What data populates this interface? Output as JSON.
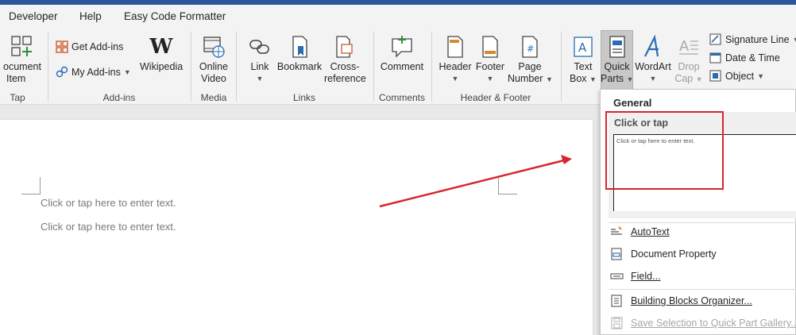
{
  "menu": {
    "developer": "Developer",
    "help": "Help",
    "easy_code_formatter": "Easy Code Formatter"
  },
  "ribbon": {
    "tap": {
      "btn_line1": "ocument",
      "btn_line2": "Item",
      "group": "Tap"
    },
    "addins": {
      "get": "Get Add-ins",
      "my": "My Add-ins",
      "wikipedia": "Wikipedia",
      "group": "Add-ins"
    },
    "media": {
      "line1": "Online",
      "line2": "Video",
      "group": "Media"
    },
    "links": {
      "link": "Link",
      "bookmark": "Bookmark",
      "crossref1": "Cross-",
      "crossref2": "reference",
      "group": "Links"
    },
    "comments": {
      "comment": "Comment",
      "group": "Comments"
    },
    "header_footer": {
      "header": "Header",
      "footer": "Footer",
      "page1": "Page",
      "page2": "Number",
      "group": "Header & Footer"
    },
    "text": {
      "textbox1": "Text",
      "textbox2": "Box",
      "quickparts1": "Quick",
      "quickparts2": "Parts",
      "wordart": "WordArt",
      "dropcap1": "Drop",
      "dropcap2": "Cap",
      "signature": "Signature Line",
      "datetime": "Date & Time",
      "object": "Object"
    }
  },
  "document": {
    "line1": "Click or tap here to enter text.",
    "line2": "Click or tap here to enter text."
  },
  "quick_parts_menu": {
    "section": "General",
    "item_title": "Click or tap",
    "item_preview": "Click or tap here to enter text.",
    "autotext": "AutoText",
    "doc_property": "Document Property",
    "field": "Field...",
    "organizer": "Building Blocks Organizer...",
    "save_selection": "Save Selection to Quick Part Gallery..."
  },
  "colors": {
    "accent": "#2b579a",
    "highlight": "#d9242c"
  }
}
